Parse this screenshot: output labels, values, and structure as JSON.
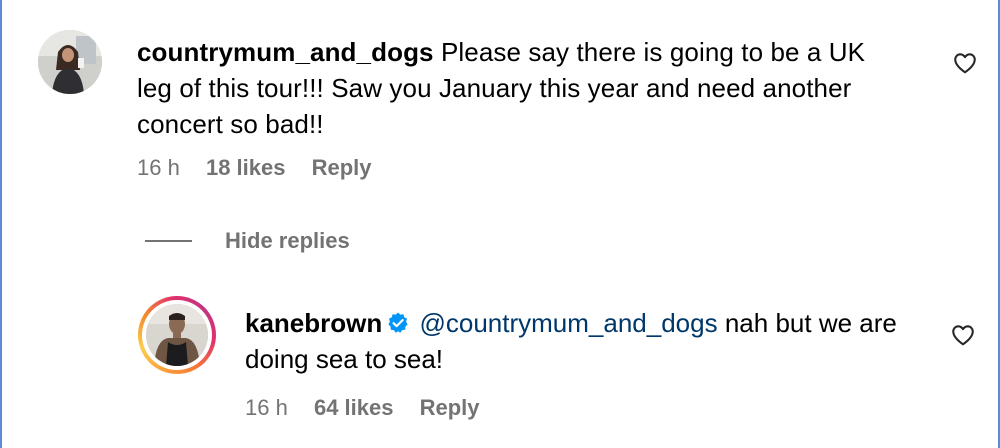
{
  "comment": {
    "username": "countrymum_and_dogs",
    "text": "Please say there is going to be a UK leg of this tour!!! Saw you January this year and need another concert so bad!!",
    "time": "16 h",
    "likes": "18 likes",
    "reply_label": "Reply"
  },
  "hide_replies_label": "Hide replies",
  "reply": {
    "username": "kanebrown",
    "verified": true,
    "mention": "@countrymum_and_dogs",
    "text": "nah but we are doing sea to sea!",
    "time": "16 h",
    "likes": "64 likes",
    "reply_label": "Reply"
  },
  "colors": {
    "meta_gray": "#737373",
    "mention_blue": "#00376b",
    "verified_blue": "#0095f6",
    "frame_border": "#5b8bd6"
  },
  "icons": {
    "like": "heart-outline-icon",
    "verified": "verified-badge-icon"
  }
}
